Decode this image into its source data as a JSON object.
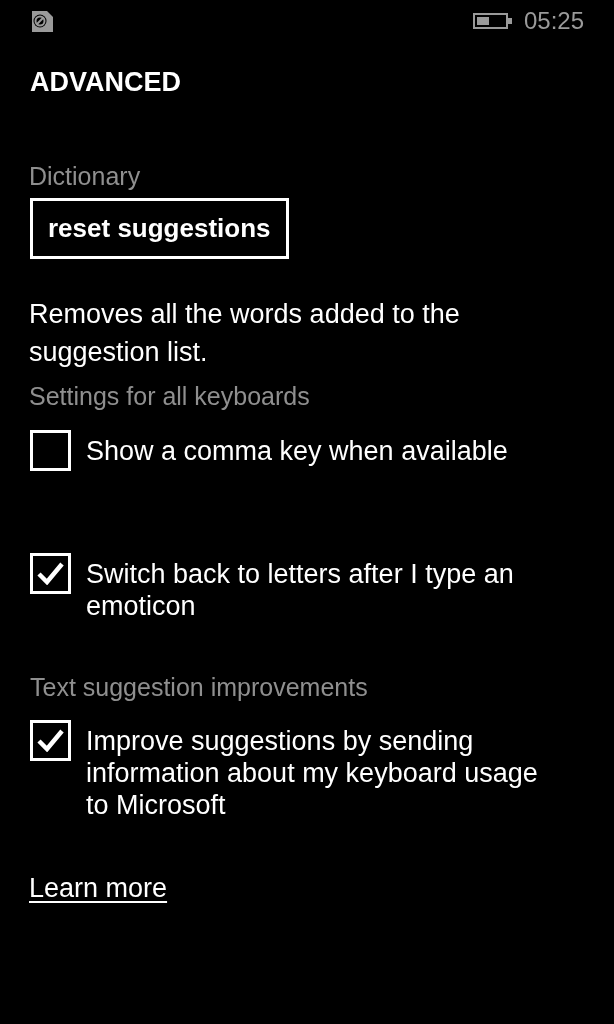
{
  "status_bar": {
    "time": "05:25"
  },
  "title": "ADVANCED",
  "dictionary": {
    "header": "Dictionary",
    "button": "reset suggestions",
    "description": "Removes all the words added to the suggestion list."
  },
  "keyboard_settings": {
    "header": "Settings for all keyboards",
    "options": [
      {
        "label": "Show a comma key when available",
        "checked": false
      },
      {
        "label": "Switch back to letters after I type an emoticon",
        "checked": true
      }
    ]
  },
  "text_suggestions": {
    "header": "Text suggestion improvements",
    "options": [
      {
        "label": "Improve suggestions by sending information about my keyboard usage to Microsoft",
        "checked": true
      }
    ]
  },
  "learn_more_link": "Learn more"
}
